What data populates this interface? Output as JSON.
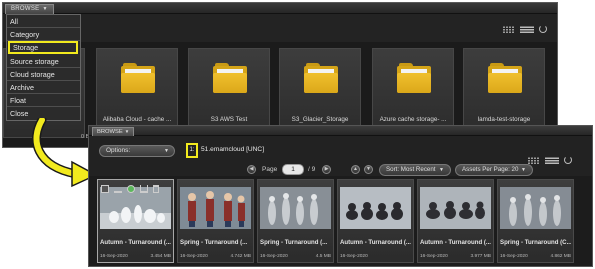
{
  "back_window": {
    "tab_label": "BROWSE",
    "tab_arrow": "▼",
    "menu_items": [
      "All",
      "Category",
      "Storage",
      "Source storage",
      "Cloud storage",
      "Archive",
      "Float",
      "Close"
    ],
    "selected_menu_item": "Storage",
    "folders": [
      "",
      "Alibaba Cloud - cache ...",
      "S3 AWS Test",
      "S3_Glacier_Storage",
      "Azure cache storage- ...",
      "lamda-test-storage"
    ],
    "size_fragment": "0 B"
  },
  "front_window": {
    "tab_label": "BROWSE",
    "tab_arrow": "▼",
    "options_label": "Options:",
    "path_number": "1:",
    "path_text": "51.emamcloud [UNC]",
    "page_label": "Page",
    "page_value": "1",
    "page_total": "/ 9",
    "sort_label": "Sort: Most Recent",
    "per_page_label": "Assets Per Page: 20",
    "assets": [
      {
        "name": "Autumn - Turnaround (...",
        "date": "16-Sep-2020",
        "size": "3.454 MB",
        "scene": "white-figures"
      },
      {
        "name": "Spring - Turnaround (...",
        "date": "16-Sep-2020",
        "size": "4.742 MB",
        "scene": "red-characters"
      },
      {
        "name": "Spring - Turnaround (...",
        "date": "16-Sep-2020",
        "size": "4.5 MB",
        "scene": "grey-figures"
      },
      {
        "name": "Autumn - Turnaround (...",
        "date": "16-Sep-2020",
        "size": "",
        "scene": "dark-creatures"
      },
      {
        "name": "Autumn - Turnaround (...",
        "date": "16-Sep-2020",
        "size": "3.977 MB",
        "scene": "dark-creatures-2"
      },
      {
        "name": "Spring - Turnaround (C...",
        "date": "16-Sep-2020",
        "size": "4.862 MB",
        "scene": "grey-figures-2"
      }
    ]
  },
  "colors": {
    "highlight": "#f2ea1e",
    "folder": "#f0c02e",
    "window_bg": "#1c1c1c"
  },
  "icons": [
    "grid-view-icon",
    "list-view-icon",
    "refresh-icon",
    "folder-icon",
    "prev-page-icon",
    "next-page-icon",
    "sort-up-icon",
    "sort-down-icon",
    "checkbox-icon",
    "download-icon",
    "share-icon",
    "transfer-icon",
    "delete-icon"
  ]
}
